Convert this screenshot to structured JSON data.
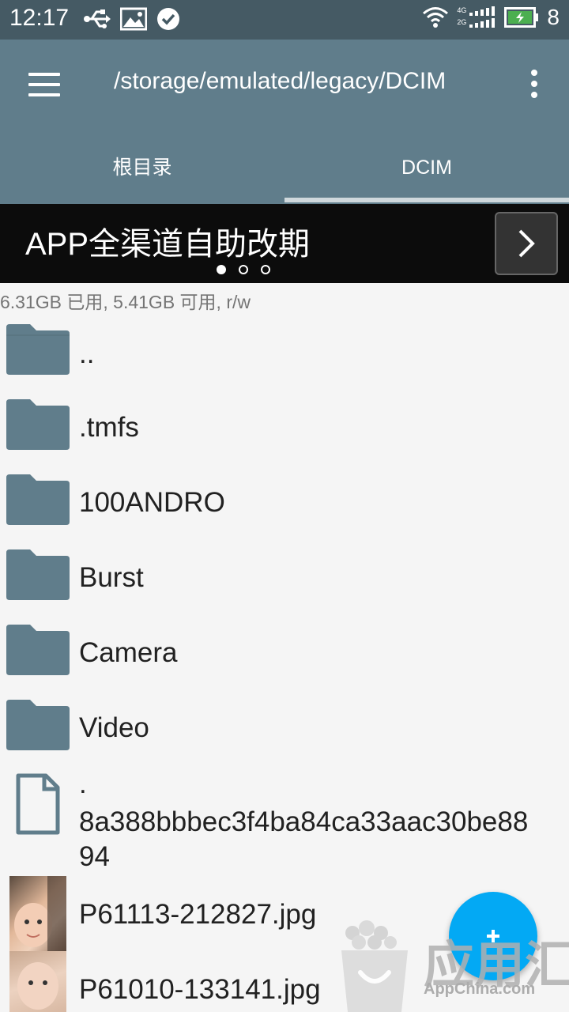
{
  "status_bar": {
    "time": "12:17",
    "icons_left": [
      "usb-icon",
      "image-icon",
      "check-circle-icon"
    ],
    "icons_right": [
      "wifi-icon",
      "signal-icon",
      "battery-charging-icon"
    ],
    "network_4g": "4G",
    "network_2g": "2G",
    "battery_level": "8"
  },
  "app_bar": {
    "path": "/storage/emulated/legacy/DCIM",
    "background": "#607d8b"
  },
  "tabs": [
    {
      "label": "根目录",
      "selected": false
    },
    {
      "label": "DCIM",
      "selected": true
    }
  ],
  "ad_banner": {
    "text": "APP全渠道自助改期",
    "page_count": 3,
    "active_page": 1
  },
  "storage_info": "6.31GB 已用, 5.41GB 可用, r/w",
  "files": [
    {
      "name": "..",
      "type": "folder"
    },
    {
      "name": ".tmfs",
      "type": "folder"
    },
    {
      "name": "100ANDRO",
      "type": "folder"
    },
    {
      "name": "Burst",
      "type": "folder"
    },
    {
      "name": "Camera",
      "type": "folder"
    },
    {
      "name": "Video",
      "type": "folder"
    },
    {
      "name_line1": ".",
      "name_line2": "8a388bbbec3f4ba84ca33aac30be88",
      "name_line3": "94",
      "type": "file"
    },
    {
      "name": "P61113-212827.jpg",
      "type": "image"
    },
    {
      "name": "P61010-133141.jpg",
      "type": "image"
    }
  ],
  "fab": {
    "icon": "plus-icon",
    "color": "#03a9f4"
  },
  "watermark": {
    "chars": "应用汇",
    "url": "AppChina.com"
  }
}
